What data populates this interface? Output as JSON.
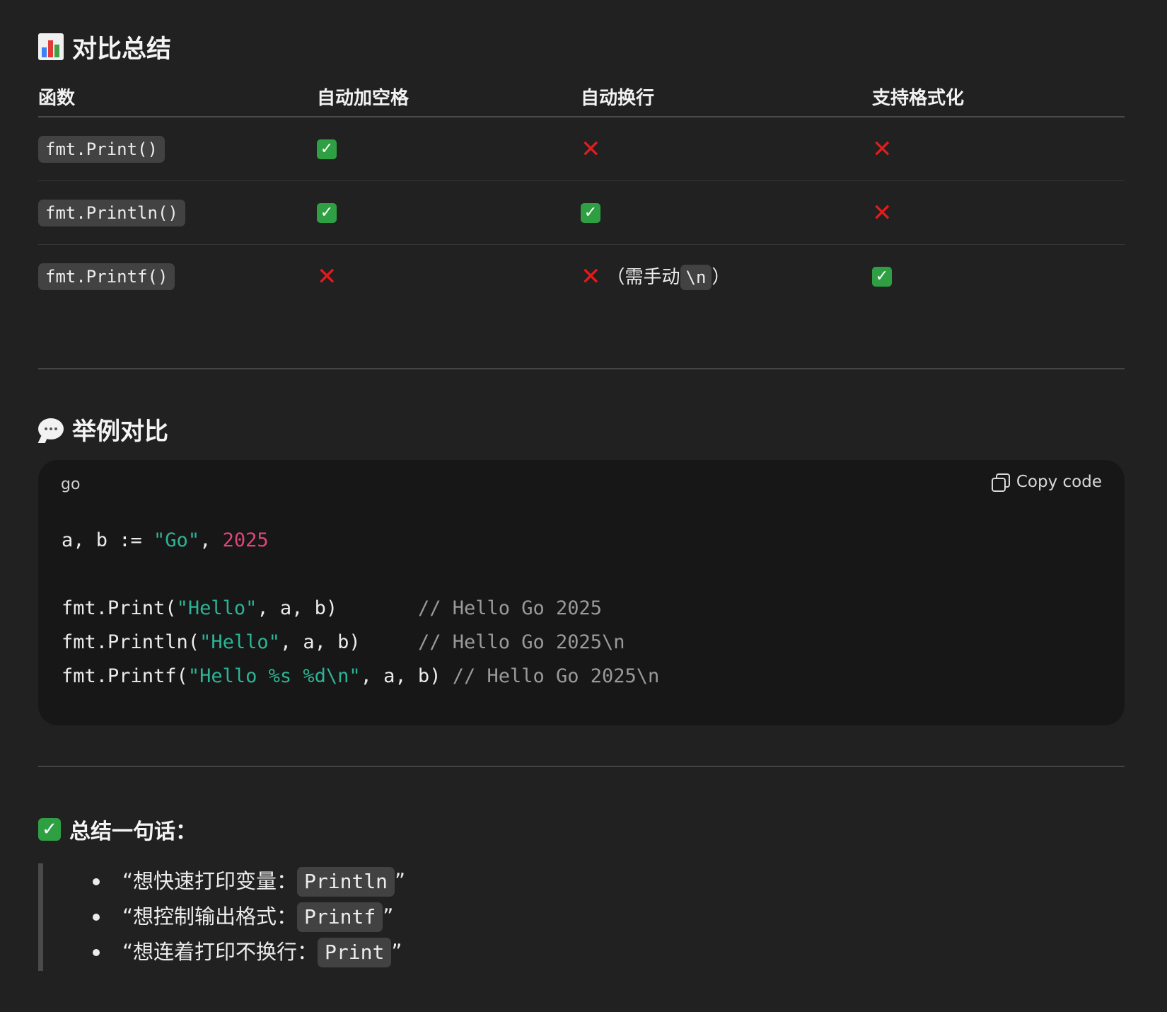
{
  "summary_section": {
    "title": "对比总结",
    "icon": "bar-chart-icon",
    "table": {
      "headers": [
        "函数",
        "自动加空格",
        "自动换行",
        "支持格式化"
      ],
      "rows": [
        {
          "func": "fmt.Print()",
          "space": "yes",
          "newline": "no",
          "format": "no"
        },
        {
          "func": "fmt.Println()",
          "space": "yes",
          "newline": "yes",
          "format": "no"
        },
        {
          "func": "fmt.Printf()",
          "space": "no",
          "newline": "no",
          "format": "yes",
          "newline_note_prefix": "（需手动",
          "newline_note_code": "\\n",
          "newline_note_suffix": "）"
        }
      ]
    }
  },
  "example_section": {
    "title": "举例对比",
    "icon": "speech-bubble-icon",
    "code_block": {
      "language": "go",
      "copy_label": "Copy code",
      "lines": [
        {
          "id": "l1",
          "parts": [
            {
              "t": "a, b := ",
              "k": "plain"
            },
            {
              "t": "\"Go\"",
              "k": "str"
            },
            {
              "t": ", ",
              "k": "plain"
            },
            {
              "t": "2025",
              "k": "num"
            }
          ]
        },
        {
          "id": "blank"
        },
        {
          "id": "l3",
          "parts": [
            {
              "t": "fmt.Print(",
              "k": "plain"
            },
            {
              "t": "\"Hello\"",
              "k": "str"
            },
            {
              "t": ", a, b)       ",
              "k": "plain"
            },
            {
              "t": "// Hello Go 2025",
              "k": "comment"
            }
          ]
        },
        {
          "id": "l4",
          "parts": [
            {
              "t": "fmt.Println(",
              "k": "plain"
            },
            {
              "t": "\"Hello\"",
              "k": "str"
            },
            {
              "t": ", a, b)     ",
              "k": "plain"
            },
            {
              "t": "// Hello Go 2025\\n",
              "k": "comment"
            }
          ]
        },
        {
          "id": "l5",
          "parts": [
            {
              "t": "fmt.Printf(",
              "k": "plain"
            },
            {
              "t": "\"Hello %s %d\\n\"",
              "k": "str"
            },
            {
              "t": ", a, b) ",
              "k": "plain"
            },
            {
              "t": "// Hello Go 2025\\n",
              "k": "comment"
            }
          ]
        }
      ]
    }
  },
  "oneline_section": {
    "title": "总结一句话：",
    "icon": "check-mark-icon",
    "items": [
      {
        "text": "“想快速打印变量：",
        "code": "Println",
        "end": "”"
      },
      {
        "text": "“想控制输出格式：",
        "code": "Printf",
        "end": "”"
      },
      {
        "text": "“想连着打印不换行：",
        "code": "Print",
        "end": "”"
      }
    ]
  },
  "colors": {
    "background": "#212121",
    "code_background": "#171717",
    "check": "#2ea043",
    "cross": "#e41b1b",
    "string": "#2bb596",
    "number": "#e0447b",
    "comment": "#9a9a9a"
  }
}
